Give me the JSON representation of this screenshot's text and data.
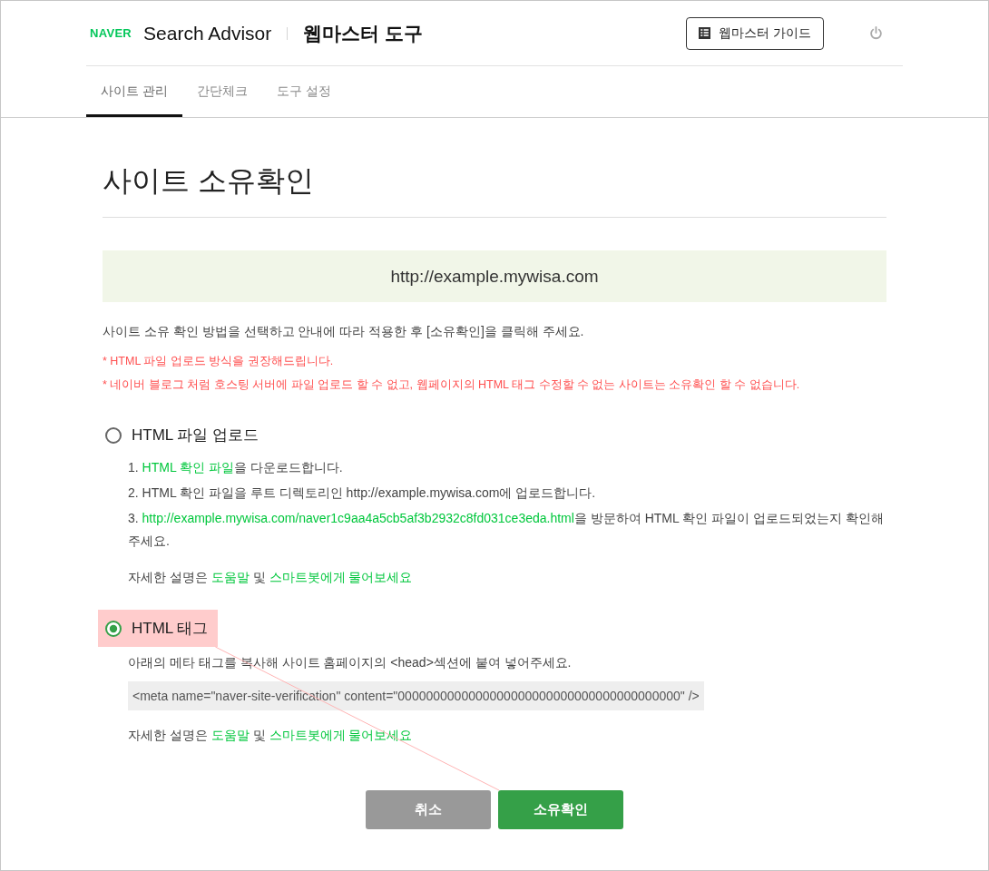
{
  "header": {
    "logo": "NAVER",
    "product": "Search Advisor",
    "section": "웹마스터 도구",
    "guide_button": "웹마스터 가이드"
  },
  "tabs": [
    {
      "label": "사이트 관리",
      "selected": true
    },
    {
      "label": "간단체크",
      "selected": false
    },
    {
      "label": "도구 설정",
      "selected": false
    }
  ],
  "page_title": "사이트 소유확인",
  "site_url": "http://example.mywisa.com",
  "instruction": "사이트 소유 확인 방법을 선택하고 안내에 따라 적용한 후 [소유확인]을 클릭해 주세요.",
  "notes": [
    "* HTML 파일 업로드 방식을 권장해드립니다.",
    "* 네이버 블로그 처럼 호스팅 서버에 파일 업로드 할 수 없고, 웹페이지의 HTML 태그 수정할 수 없는 사이트는 소유확인 할 수 없습니다."
  ],
  "methods": [
    {
      "kind": "file",
      "label": "HTML 파일 업로드",
      "selected": false,
      "highlighted": false,
      "steps": [
        {
          "number": "1.",
          "parts": [
            {
              "kind": "link",
              "text": "HTML 확인 파일"
            },
            {
              "kind": "text",
              "text": "을 다운로드합니다."
            }
          ]
        },
        {
          "number": "2.",
          "parts": [
            {
              "kind": "text",
              "text": "HTML 확인 파일을 루트 디렉토리인 http://example.mywisa.com에 업로드합니다."
            }
          ]
        },
        {
          "number": "3.",
          "parts": [
            {
              "kind": "link",
              "text": "http://example.mywisa.com/naver1c9aa4a5cb5af3b2932c8fd031ce3eda.html"
            },
            {
              "kind": "text",
              "text": "을 방문하여 HTML 확인 파일이 업로드되었는지 확인해 주세요."
            }
          ]
        }
      ],
      "help": [
        {
          "kind": "text",
          "text": "자세한 설명은 "
        },
        {
          "kind": "link",
          "text": "도움말"
        },
        {
          "kind": "text",
          "text": " 및 "
        },
        {
          "kind": "link",
          "text": "스마트봇에게 물어보세요"
        }
      ]
    },
    {
      "kind": "tag",
      "label": "HTML 태그",
      "selected": true,
      "highlighted": true,
      "description": "아래의 메타 태그를 복사해 사이트 홈페이지의 <head>섹션에 붙여 넣어주세요.",
      "code": "<meta name=\"naver-site-verification\" content=\"0000000000000000000000000000000000000000\" />",
      "help": [
        {
          "kind": "text",
          "text": "자세한 설명은 "
        },
        {
          "kind": "link",
          "text": "도움말"
        },
        {
          "kind": "text",
          "text": " 및 "
        },
        {
          "kind": "link",
          "text": "스마트봇에게 물어보세요"
        }
      ]
    }
  ],
  "buttons": [
    {
      "kind": "cancel",
      "label": "취소"
    },
    {
      "kind": "confirm",
      "label": "소유확인"
    }
  ]
}
